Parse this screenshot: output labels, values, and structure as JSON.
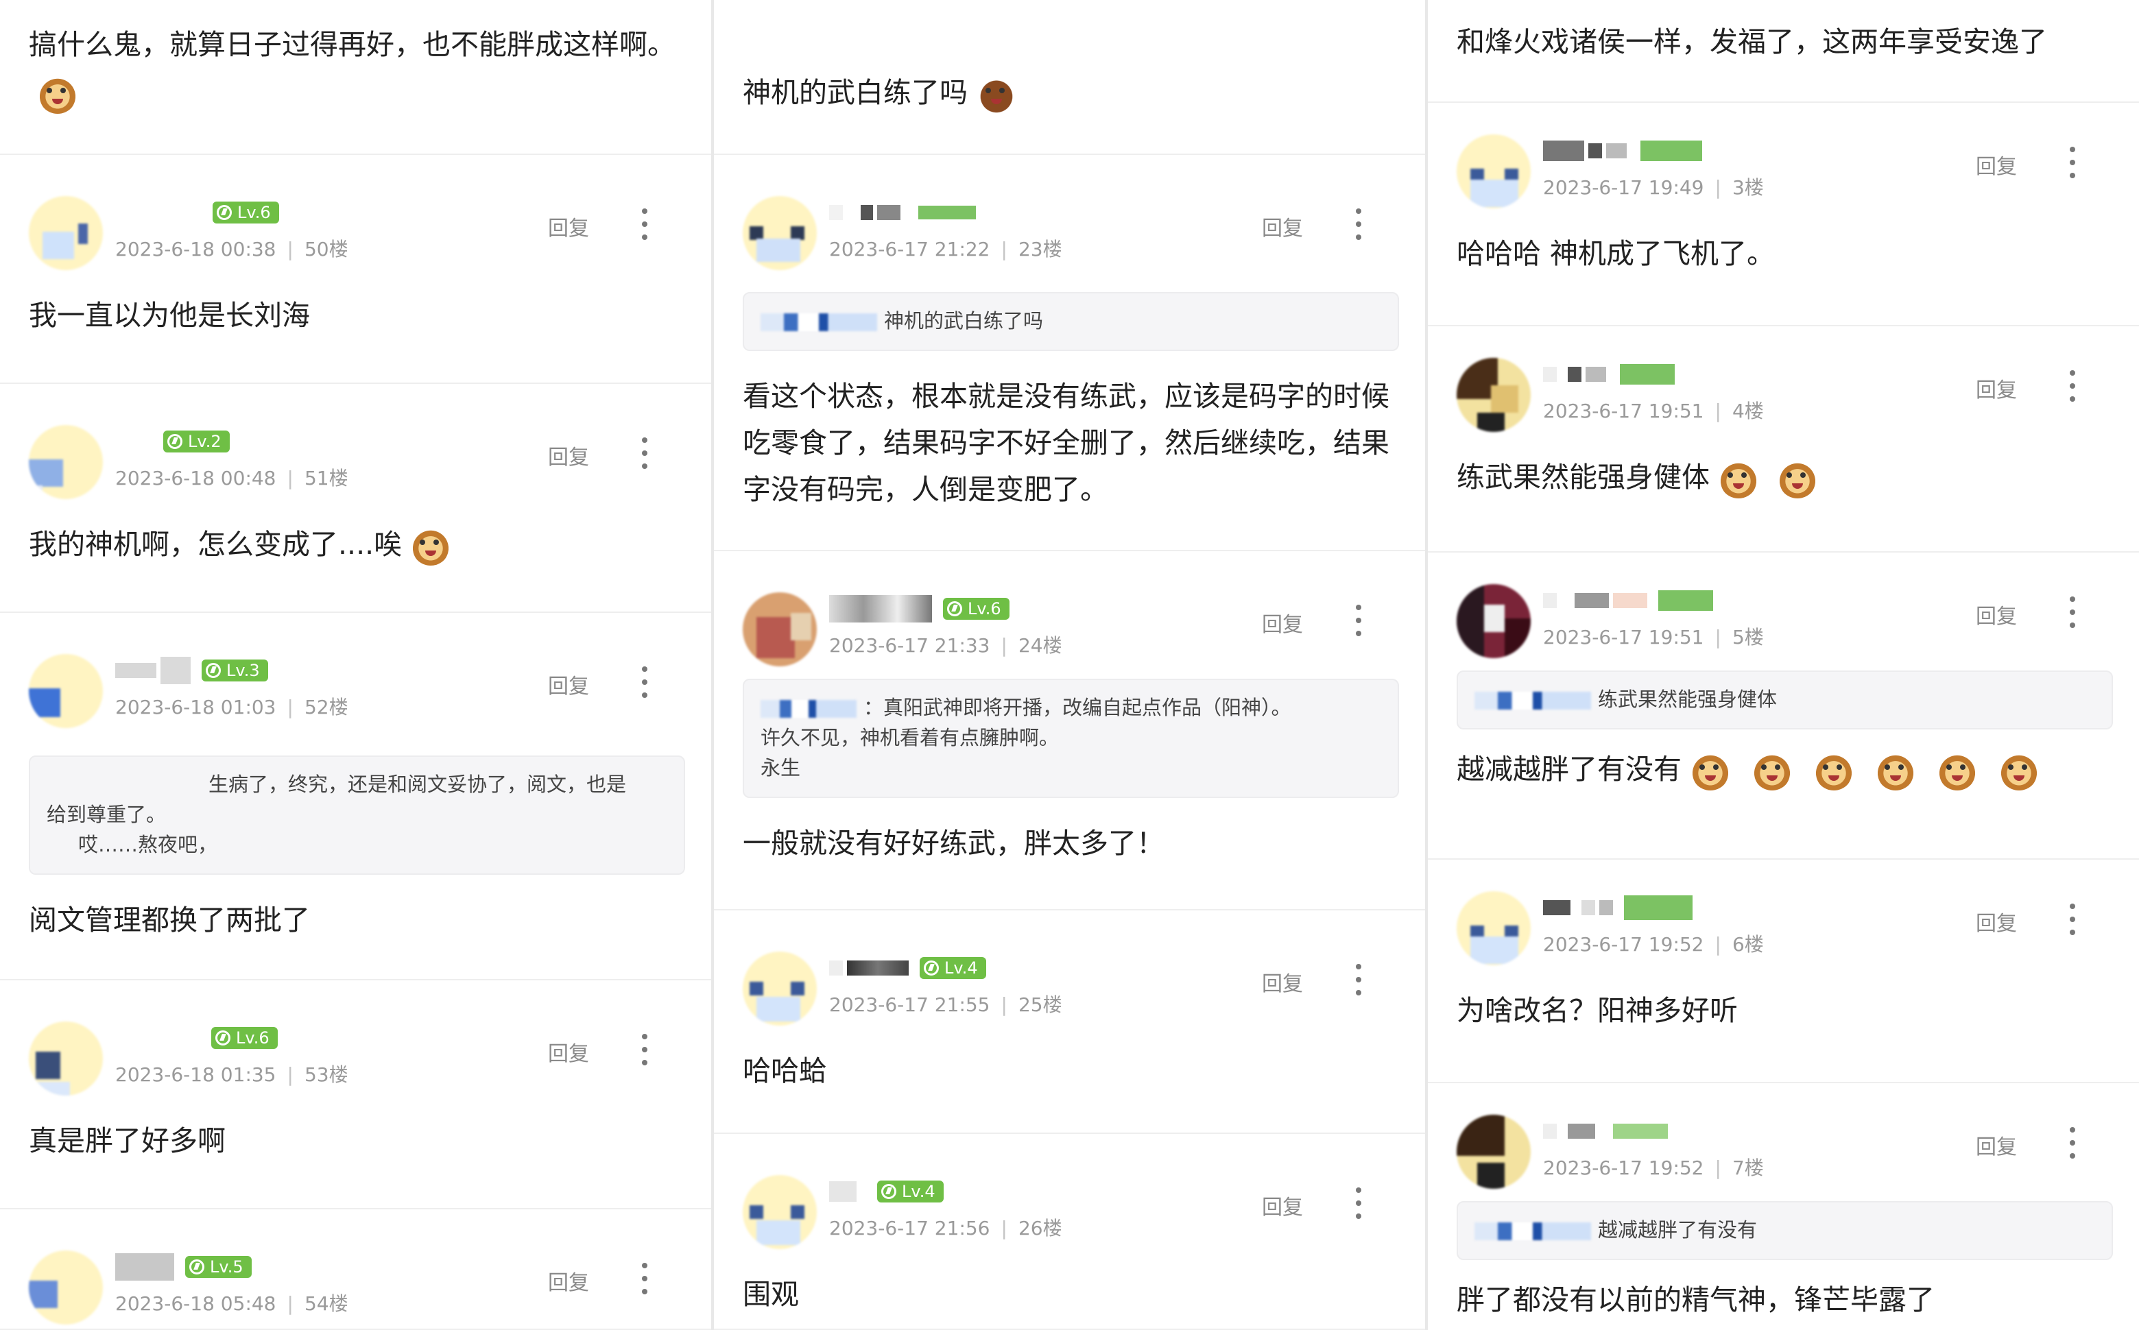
{
  "colors": {
    "level_badge": "#6fbf45",
    "meta_text": "#9a9a9a",
    "quote_bg": "#f5f5f7"
  },
  "icons": {
    "more": "more-vertical-icon",
    "level": "level-badge-icon",
    "emoji": "monkey-emoji-icon"
  },
  "columns": [
    {
      "lead": {
        "text": "搞什么鬼，就算日子过得再好，也不能胖成这样啊。",
        "emojis": 1
      },
      "comments": [
        {
          "level": "Lv.6",
          "time": "2023-6-18 00:38",
          "floor": "50楼",
          "reply": "回复",
          "text": "我一直以为他是长刘海",
          "emojis": 0,
          "avatar": "a1"
        },
        {
          "level": "Lv.2",
          "time": "2023-6-18 00:48",
          "floor": "51楼",
          "reply": "回复",
          "text": "我的神机啊，怎么变成了....唉",
          "emojis": 1,
          "avatar": "a2"
        },
        {
          "level": "Lv.3",
          "time": "2023-6-18 01:03",
          "floor": "52楼",
          "reply": "回复",
          "quote": [
            "生病了，终究，还是和阅文妥协了，阅文，也是",
            "给到尊重了。",
            "哎……熬夜吧，"
          ],
          "text": "阅文管理都换了两批了",
          "emojis": 0,
          "avatar": "a3"
        },
        {
          "level": "Lv.6",
          "time": "2023-6-18 01:35",
          "floor": "53楼",
          "reply": "回复",
          "text": "真是胖了好多啊",
          "emojis": 0,
          "avatar": "a4"
        },
        {
          "level": "Lv.5",
          "time": "2023-6-18 05:48",
          "floor": "54楼",
          "reply": "回复",
          "text": "",
          "emojis": 0,
          "avatar": "a5"
        }
      ]
    },
    {
      "lead": {
        "text": "神机的武白练了吗",
        "emojis": 1
      },
      "comments": [
        {
          "level": "",
          "time": "2023-6-17 21:22",
          "floor": "23楼",
          "reply": "回复",
          "quote": [
            "神机的武白练了吗"
          ],
          "text": "看这个状态，根本就是没有练武，应该是码字的时候吃零食了，结果码字不好全删了，然后继续吃，结果字没有码完，人倒是变肥了。",
          "emojis": 0,
          "avatar": "b1"
        },
        {
          "level": "Lv.6",
          "time": "2023-6-17 21:33",
          "floor": "24楼",
          "reply": "回复",
          "quote": [
            "：真阳武神即将开播，改编自起点作品（阳神）。",
            "许久不见，神机看着有点臃肿啊。",
            "永生"
          ],
          "text": "一般就没有好好练武，胖太多了！",
          "emojis": 0,
          "avatar": "b2"
        },
        {
          "level": "Lv.4",
          "time": "2023-6-17 21:55",
          "floor": "25楼",
          "reply": "回复",
          "text": "哈哈蛤",
          "emojis": 0,
          "avatar": "b3"
        },
        {
          "level": "Lv.4",
          "time": "2023-6-17 21:56",
          "floor": "26楼",
          "reply": "回复",
          "text": "围观",
          "emojis": 0,
          "avatar": "b4"
        }
      ]
    },
    {
      "lead": {
        "text": "和烽火戏诸侯一样，发福了，这两年享受安逸了",
        "emojis": 0
      },
      "comments": [
        {
          "level": "",
          "time": "2023-6-17 19:49",
          "floor": "3楼",
          "reply": "回复",
          "text": "哈哈哈 神机成了飞机了。",
          "emojis": 0,
          "avatar": "c1"
        },
        {
          "level": "",
          "time": "2023-6-17 19:51",
          "floor": "4楼",
          "reply": "回复",
          "text": "练武果然能强身健体",
          "emojis": 2,
          "avatar": "c2"
        },
        {
          "level": "",
          "time": "2023-6-17 19:51",
          "floor": "5楼",
          "reply": "回复",
          "quote": [
            "练武果然能强身健体"
          ],
          "text": "越减越胖了有没有",
          "emojis": 6,
          "avatar": "c3"
        },
        {
          "level": "",
          "time": "2023-6-17 19:52",
          "floor": "6楼",
          "reply": "回复",
          "text": "为啥改名？阳神多好听",
          "emojis": 0,
          "avatar": "c4"
        },
        {
          "level": "",
          "time": "2023-6-17 19:52",
          "floor": "7楼",
          "reply": "回复",
          "quote": [
            "越减越胖了有没有"
          ],
          "text": "胖了都没有以前的精气神，锋芒毕露了",
          "emojis": 0,
          "avatar": "c5"
        }
      ]
    }
  ]
}
